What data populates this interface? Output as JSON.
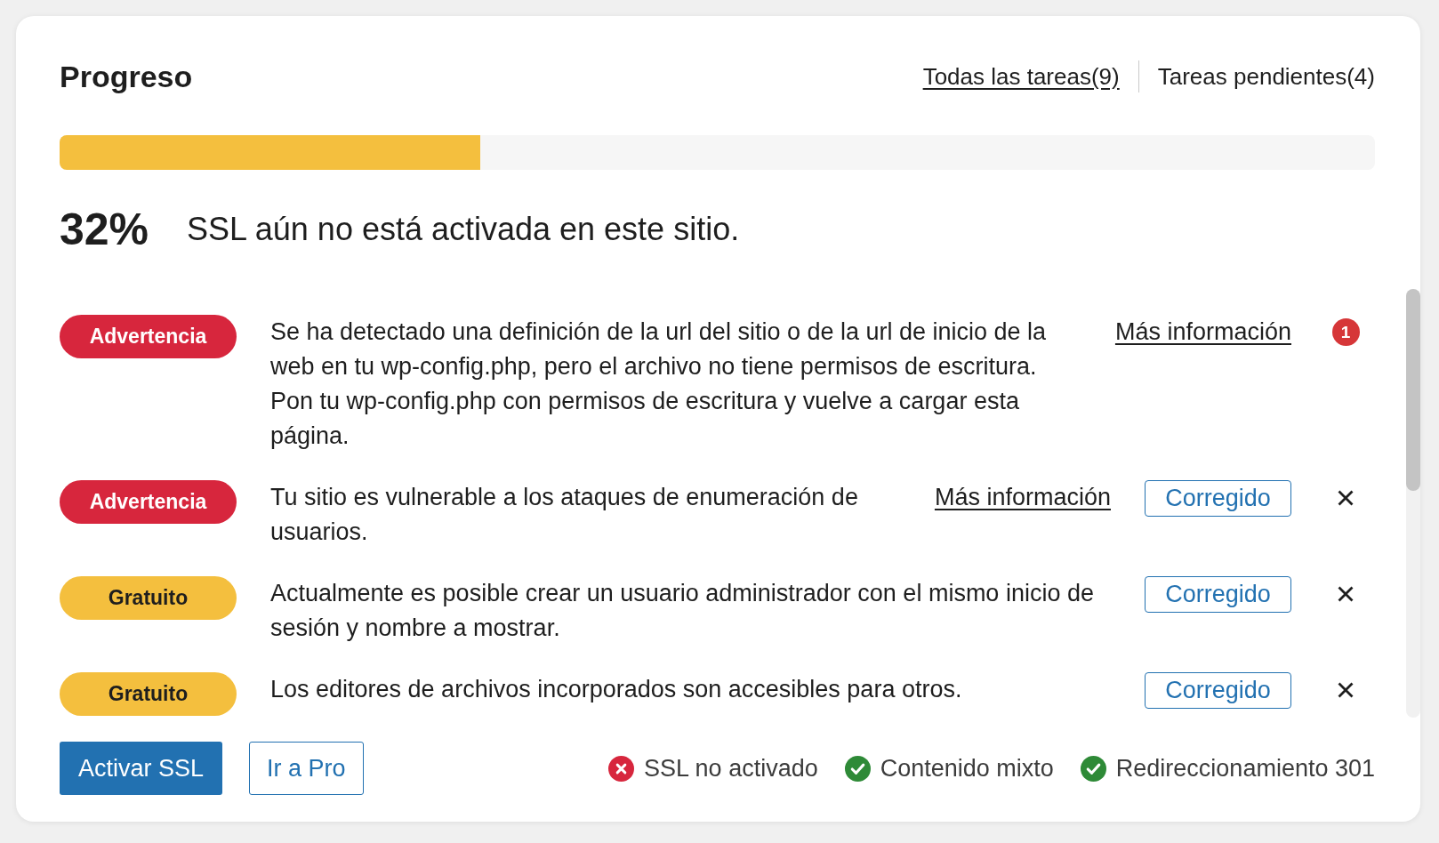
{
  "header": {
    "title": "Progreso",
    "filters": [
      {
        "label": "Todas las tareas(9)",
        "selected": true
      },
      {
        "label": "Tareas pendientes(4)",
        "selected": false
      }
    ]
  },
  "progress": {
    "level": 0.32,
    "percent": "32%",
    "message": "SSL aún no está activada en este sitio."
  },
  "tasks": [
    {
      "badge": {
        "label": "Advertencia",
        "color": "#d7263d"
      },
      "message": "Se ha detectado una definición de la url del sitio o de la url de inicio de la web en tu wp-config.php, pero el archivo no tiene permisos de escritura. Pon tu wp-config.php con permisos de escritura y vuelve a cargar esta página.",
      "link": "Más información",
      "count": "1",
      "dismissible": false
    },
    {
      "badge": {
        "label": "Advertencia",
        "color": "#d7263d"
      },
      "message": "Tu sitio es vulnerable a los ataques de enumeración de usuarios.",
      "link": "Más información",
      "button": "Corregido",
      "dismissible": true
    },
    {
      "badge": {
        "label": "Gratuito",
        "color": "#f4bf3e"
      },
      "message": "Actualmente es posible crear un usuario administrador con el mismo inicio de sesión y nombre a mostrar.",
      "button": "Corregido",
      "dismissible": true
    },
    {
      "badge": {
        "label": "Gratuito",
        "color": "#f4bf3e"
      },
      "message": "Los editores de archivos incorporados son accesibles para otros.",
      "button": "Corregido",
      "dismissible": true
    }
  ],
  "footer": {
    "buttons": [
      {
        "label": "Activar SSL",
        "kind": "primary"
      },
      {
        "label": "Ir a Pro",
        "kind": "secondary"
      }
    ],
    "status": [
      {
        "label": "SSL no activado",
        "ok": false
      },
      {
        "label": "Contenido mixto",
        "ok": true
      },
      {
        "label": "Redireccionamiento 301",
        "ok": true
      }
    ]
  }
}
